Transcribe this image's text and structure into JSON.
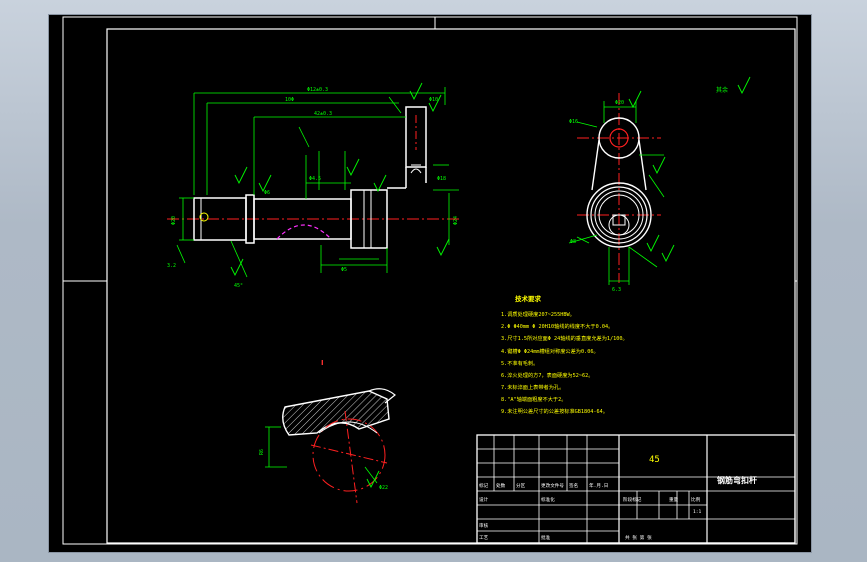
{
  "drawing": {
    "material": "45",
    "part_name": "钢筋弯扣杆",
    "scale": "1:1",
    "view_label": "I",
    "roughness_note": "其余",
    "tech_requirements": {
      "title": "技术要求",
      "items": [
        "1.调质处理硬度207~255HBW。",
        "2.Φ Φ40mm Φ 20H10轴线的线度不大于0.04。",
        "3.尺寸1.5所对应面Φ 24轴线的垂直度允差为1/100。",
        "4.键槽Φ Φ24mm槽组对称度公差为0.06。",
        "5.不准有毛刺。",
        "6.淬火处理的方7，表面硬度为52~62。",
        "7.未标淬面上表带者为孔。",
        "8.\"A\"轴端面粗度不大于2。",
        "9.未注明公差尺寸的公差按标准GB1804-64。"
      ]
    },
    "title_block": {
      "row_labels": [
        "标记",
        "处数",
        "分区",
        "更改文件号",
        "签名",
        "年.月.日"
      ],
      "design_label": "设计",
      "standard_label": "标准化",
      "stage_label": "阶段标记",
      "weight_label": "重量",
      "scale_label": "比例",
      "review_label": "审核",
      "process_label": "工艺",
      "approve_label": "批准",
      "sheet_label": "共 张 第 张"
    },
    "dims": {
      "top1": "Φ12±0.3",
      "top2": "10Φ",
      "top3": "42±0.3",
      "top4": "Φ10",
      "left1": "Φ20",
      "left2": "Φ16",
      "small1": "Φ6",
      "small2": "Φ4.5",
      "right1": "Φ18",
      "right2": "Φ24",
      "bottom1": "Φ5",
      "bottom2": "3.2",
      "angle1": "45°",
      "circle1": "Φ20",
      "circle2": "Φ16",
      "circle3": "Φ8",
      "sect1": "R6",
      "sect2": "Φ22",
      "roughness": "6.3"
    }
  }
}
